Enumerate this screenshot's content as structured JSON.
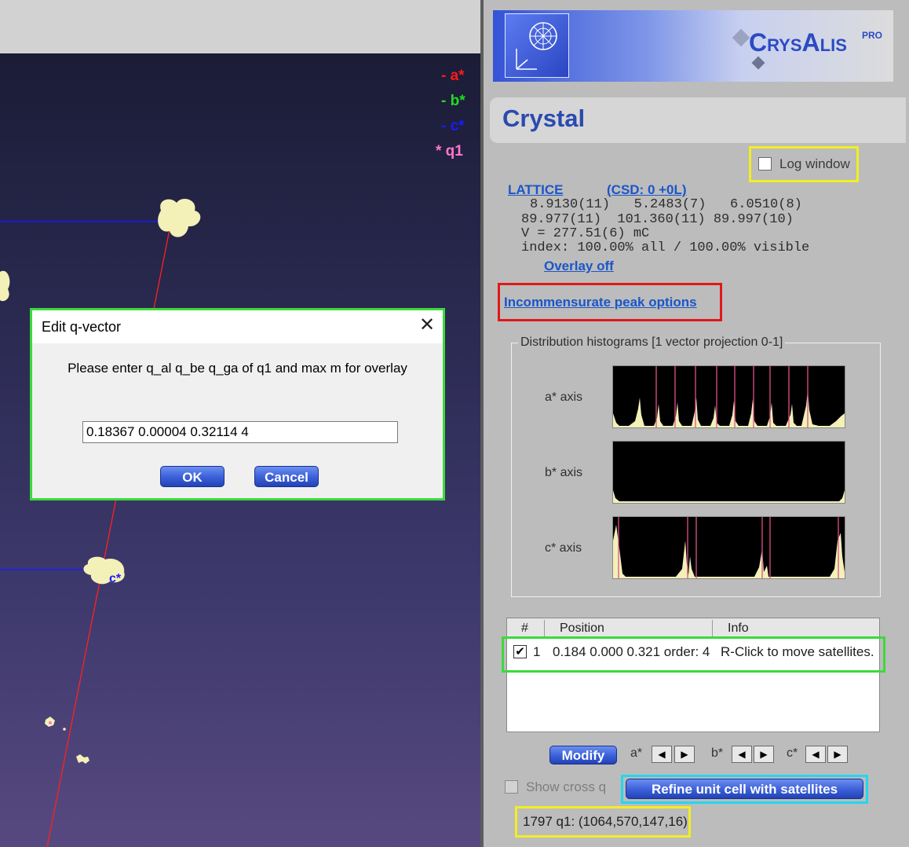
{
  "viewer": {
    "axis_labels": {
      "a": "- a*",
      "b": "- b*",
      "c": "- c*",
      "q": "* q1"
    },
    "c_star_tag": "c*",
    "colors": {
      "a": "#ff1a1a",
      "b": "#22dd22",
      "c": "#1a1aff",
      "q": "#ff77cc",
      "peak": "#f3f0b8"
    }
  },
  "dialog": {
    "title": "Edit q-vector",
    "close": "✕",
    "prompt": "Please enter q_al q_be q_ga of q1 and max m for overlay",
    "input_value": "0.18367 0.00004 0.32114 4",
    "ok": "OK",
    "cancel": "Cancel"
  },
  "panel": {
    "logo": "CrysAlis",
    "logo_pro": "PRO",
    "title": "Crystal",
    "log_window": "Log window",
    "lattice_link": "LATTICE",
    "csd_link": "(CSD: 0 +0L)",
    "lattice_lines": [
      "8.9130(11)   5.2483(7)   6.0510(8)",
      "89.977(11)  101.360(11) 89.997(10)",
      "V = 277.51(6) mC",
      "index: 100.00% all / 100.00% visible"
    ],
    "overlay_off": "Overlay off",
    "incommensurate": "Incommensurate peak options",
    "dist_title": "Distribution histograms [1 vector projection 0-1]",
    "hist_labels": [
      "a* axis",
      "b* axis",
      "c* axis"
    ],
    "table": {
      "headers": [
        "#",
        "Position",
        "Info"
      ],
      "row": {
        "checked": "✔",
        "num": "1",
        "position": "0.184 0.000 0.321 order: 4",
        "info": "R-Click to move satellites."
      }
    },
    "modify": "Modify",
    "axis_steppers": [
      "a*",
      "b*",
      "c*"
    ],
    "arrow_left": "◀",
    "arrow_right": "▶",
    "show_cross_q": "Show cross q",
    "refine": "Refine unit cell with satellites",
    "status": "1797 q1: (1064,570,147,16)"
  }
}
